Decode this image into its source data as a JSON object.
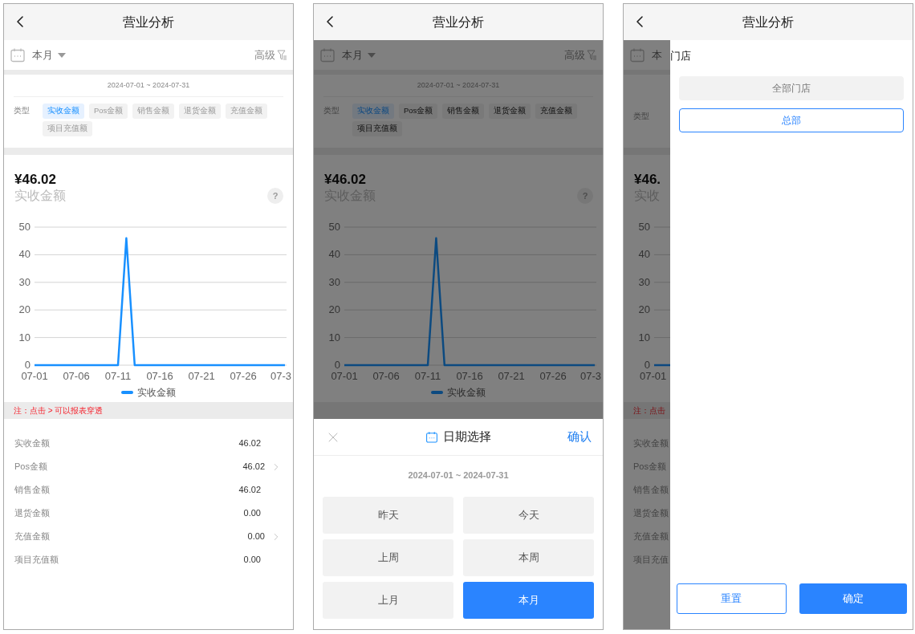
{
  "screens": [
    {
      "kind": "report",
      "header": {
        "title": "营业分析"
      },
      "report": {
        "period": "本月",
        "advanced": "高级",
        "date_range": "2024-07-01 ~ 2024-07-31",
        "type_label": "类型",
        "types": [
          {
            "label": "实收金额",
            "selected": true
          },
          {
            "label": "Pos金额",
            "selected": false
          },
          {
            "label": "销售金额",
            "selected": false
          },
          {
            "label": "退货金额",
            "selected": false
          },
          {
            "label": "充值金额",
            "selected": false
          },
          {
            "label": "项目充值额",
            "selected": false
          }
        ],
        "amount": "¥46.02",
        "amount_label": "实收金额",
        "help": "?",
        "chart_data": {
          "type": "line",
          "grid": true,
          "categories": [
            "07-01",
            null,
            null,
            null,
            null,
            "07-06",
            null,
            null,
            null,
            null,
            "07-11",
            null,
            null,
            null,
            null,
            "07-16",
            null,
            null,
            null,
            null,
            "07-21",
            null,
            null,
            null,
            null,
            "07-26",
            null,
            null,
            null,
            null,
            "07-3"
          ],
          "series": [
            {
              "name": "实收金额",
              "color": "#1890ff",
              "values": [
                0,
                0,
                0,
                0,
                0,
                0,
                0,
                0,
                0,
                0,
                0,
                46,
                0,
                0,
                0,
                0,
                0,
                0,
                0,
                0,
                0,
                0,
                0,
                0,
                0,
                0,
                0,
                0,
                0,
                0,
                0
              ]
            }
          ],
          "ylim": [
            0,
            50
          ],
          "yticks": [
            0,
            10,
            20,
            30,
            40,
            50
          ]
        },
        "note": "注：点击 > 可以报表穿透",
        "rows": [
          {
            "label": "实收金额",
            "value": "46.02",
            "drill": false
          },
          {
            "label": "Pos金额",
            "value": "46.02",
            "drill": true
          },
          {
            "label": "销售金额",
            "value": "46.02",
            "drill": false
          },
          {
            "label": "退货金额",
            "value": "0.00",
            "drill": false
          },
          {
            "label": "充值金额",
            "value": "0.00",
            "drill": true
          },
          {
            "label": "项目充值额",
            "value": "0.00",
            "drill": false
          }
        ]
      }
    },
    {
      "kind": "date_sheet",
      "header": {
        "title": "营业分析"
      },
      "report": {
        "period": "本月",
        "advanced": "高级",
        "date_range": "2024-07-01 ~ 2024-07-31",
        "type_label": "类型",
        "types": [
          {
            "label": "实收金额",
            "selected": true
          },
          {
            "label": "Pos金额",
            "selected": false
          },
          {
            "label": "销售金额",
            "selected": false
          },
          {
            "label": "退货金额",
            "selected": false
          },
          {
            "label": "充值金额",
            "selected": false
          },
          {
            "label": "项目充值额",
            "selected": false
          }
        ],
        "amount": "¥46.02",
        "amount_label": "实收金额",
        "help": "?",
        "chart_data": {
          "type": "line",
          "grid": true,
          "categories": [
            "07-01",
            null,
            null,
            null,
            null,
            "07-06",
            null,
            null,
            null,
            null,
            "07-11",
            null,
            null,
            null,
            null,
            "07-16",
            null,
            null,
            null,
            null,
            "07-21",
            null,
            null,
            null,
            null,
            "07-26",
            null,
            null,
            null,
            null,
            "07-3"
          ],
          "series": [
            {
              "name": "实收金额",
              "color": "#0c4a80",
              "values": [
                0,
                0,
                0,
                0,
                0,
                0,
                0,
                0,
                0,
                0,
                0,
                46,
                0,
                0,
                0,
                0,
                0,
                0,
                0,
                0,
                0,
                0,
                0,
                0,
                0,
                0,
                0,
                0,
                0,
                0,
                0
              ]
            }
          ],
          "ylim": [
            0,
            50
          ],
          "yticks": [
            0,
            10,
            20,
            30,
            40,
            50
          ]
        }
      },
      "sheet": {
        "title": "日期选择",
        "confirm": "确认",
        "range": "2024-07-01 ~ 2024-07-31",
        "options": [
          {
            "label": "昨天",
            "selected": false
          },
          {
            "label": "今天",
            "selected": false
          },
          {
            "label": "上周",
            "selected": false
          },
          {
            "label": "本周",
            "selected": false
          },
          {
            "label": "上月",
            "selected": false
          },
          {
            "label": "本月",
            "selected": true
          }
        ]
      }
    },
    {
      "kind": "store_drawer",
      "header": {
        "title": "营业分析"
      },
      "strip": {
        "period": "本",
        "type_label": "类型",
        "amount": "¥46.",
        "amount_label": "实收",
        "yticks": [
          "50",
          "40",
          "30",
          "20",
          "10",
          "0"
        ],
        "xtick": "07-01",
        "note": "注：点击",
        "rows": [
          "实收金额",
          "Pos金额",
          "销售金额",
          "退货金额",
          "充值金额",
          "项目充值"
        ]
      },
      "drawer": {
        "title": "门店",
        "options": [
          {
            "label": "全部门店",
            "selected": false
          },
          {
            "label": "总部",
            "selected": true
          }
        ],
        "reset": "重置",
        "ok": "确定"
      }
    }
  ]
}
